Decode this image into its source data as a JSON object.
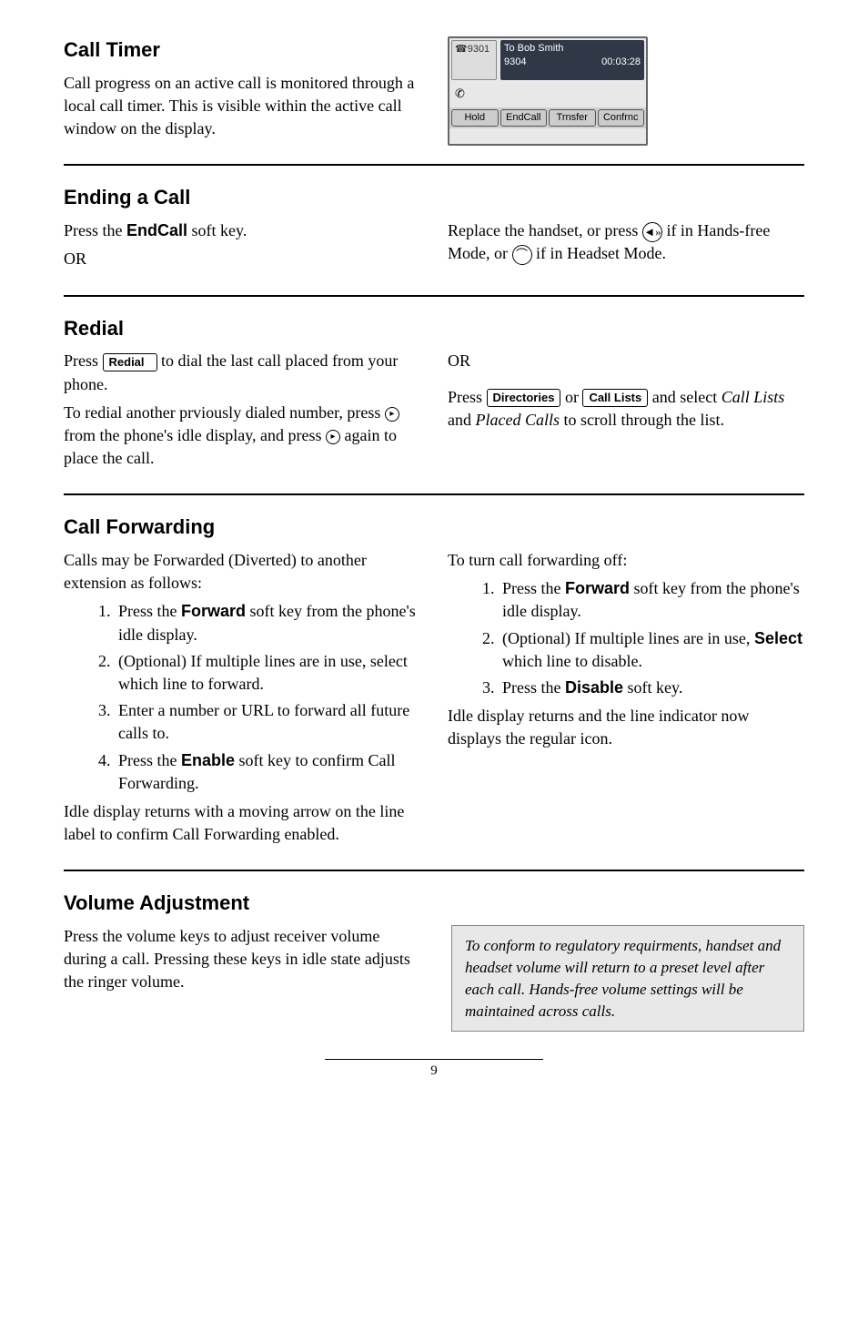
{
  "call_timer": {
    "heading": "Call Timer",
    "body": "Call progress on an active call is monitored through a local call timer.  This is visible within the active call window on the display."
  },
  "phone_screen": {
    "ext": "9301",
    "title_line1": "To Bob Smith",
    "number": "9304",
    "timer": "00:03:28",
    "softkeys": [
      "Hold",
      "EndCall",
      "Trnsfer",
      "Confrnc"
    ]
  },
  "ending_call": {
    "heading": "Ending a Call",
    "left_pre": "Press the ",
    "endcall_label": "EndCall",
    "left_post": " soft key.",
    "or": "OR",
    "right_pre": "Replace the handset, or press ",
    "right_mid": " if in Hands-free Mode, or ",
    "right_post": " if in Headset Mode."
  },
  "redial": {
    "heading": "Redial",
    "press": "Press ",
    "redial_key": "Redial",
    "after_redial": " to dial the last call placed from your phone.",
    "para2_pre": "To redial another prviously dialed number, press ",
    "para2_mid": " from the phone's idle display, and press ",
    "para2_post": " again to place the call.",
    "or": "OR",
    "right_press": "Press ",
    "dir_key": "Directories",
    "or_word": " or ",
    "calllists_key": "Call Lists",
    "right_post1": " and select ",
    "italic1": "Call Lists",
    "and": " and ",
    "italic2": "Placed Calls",
    "right_end": " to scroll through the list."
  },
  "forwarding": {
    "heading": "Call Forwarding",
    "intro": "Calls may be Forwarded (Diverted) to another extension as follows:",
    "steps_on": {
      "s1_pre": "Press the ",
      "s1_b": "Forward",
      "s1_post": " soft key from the phone's idle display.",
      "s2": "(Optional) If multiple lines are in use, select which line to forward.",
      "s3": "Enter a number or URL to forward all future calls to.",
      "s4_pre": "Press the ",
      "s4_b": "Enable",
      "s4_post": " soft key to confirm Call Forwarding."
    },
    "after_on": "Idle display returns with a moving arrow on the line label to confirm Call Forwarding enabled.",
    "off_intro": "To turn call forwarding off:",
    "steps_off": {
      "s1_pre": "Press the ",
      "s1_b": "Forward",
      "s1_post": " soft key from the phone's idle display.",
      "s2_pre": "(Optional) If multiple lines are in use, ",
      "s2_b": "Select",
      "s2_post": " which line to disable.",
      "s3_pre": "Press the ",
      "s3_b": "Disable",
      "s3_post": " soft key."
    },
    "after_off": "Idle display returns and the line indicator now displays the regular icon."
  },
  "volume": {
    "heading": "Volume Adjustment",
    "body": "Press the volume keys to adjust receiver volume during a call.  Pressing these keys in idle state adjusts the ringer volume.",
    "note": "To conform to regulatory requirments, handset and headset volume will return to a preset level after each call.  Hands-free volume settings will be maintained across calls."
  },
  "page_number": "9"
}
